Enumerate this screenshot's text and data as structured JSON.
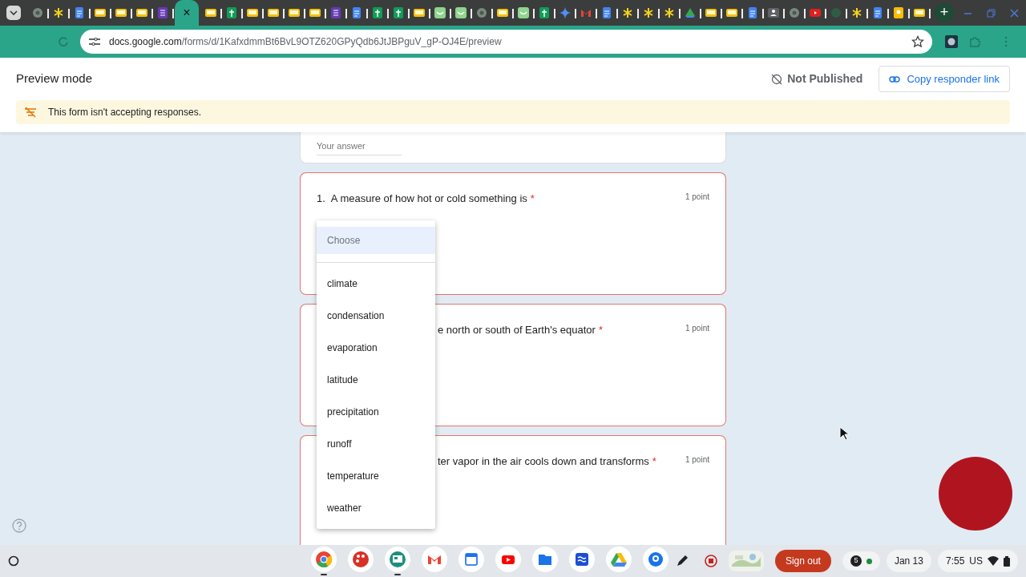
{
  "browser": {
    "tabs": [
      {
        "kind": "chrome",
        "selected": false
      },
      {
        "kind": "star",
        "selected": false
      },
      {
        "kind": "docs",
        "selected": false
      },
      {
        "kind": "slides",
        "selected": false
      },
      {
        "kind": "slides",
        "selected": false
      },
      {
        "kind": "slides",
        "selected": false
      },
      {
        "kind": "forms",
        "selected": false
      },
      {
        "selected": true,
        "close": "×"
      },
      {
        "kind": "slides",
        "selected": false
      },
      {
        "kind": "sheets",
        "selected": false
      },
      {
        "kind": "slides",
        "selected": false
      },
      {
        "kind": "slides",
        "selected": false
      },
      {
        "kind": "slides",
        "selected": false
      },
      {
        "kind": "slides",
        "selected": false
      },
      {
        "kind": "forms",
        "selected": false
      },
      {
        "kind": "docs",
        "selected": false
      },
      {
        "kind": "sheets",
        "selected": false
      },
      {
        "kind": "sheets",
        "selected": false
      },
      {
        "kind": "slides",
        "selected": false
      },
      {
        "kind": "smile",
        "selected": false
      },
      {
        "kind": "smile",
        "selected": false
      },
      {
        "kind": "chrome",
        "selected": false
      },
      {
        "kind": "slides",
        "selected": false
      },
      {
        "kind": "smile",
        "selected": false
      },
      {
        "kind": "sheets",
        "selected": false
      },
      {
        "kind": "gemini",
        "selected": false
      },
      {
        "kind": "gmail",
        "selected": false
      },
      {
        "kind": "docs",
        "selected": false
      },
      {
        "kind": "star",
        "selected": false
      },
      {
        "kind": "star",
        "selected": false
      },
      {
        "kind": "star",
        "selected": false
      },
      {
        "kind": "drive",
        "selected": false
      },
      {
        "kind": "slides",
        "selected": false
      },
      {
        "kind": "slides",
        "selected": false
      },
      {
        "kind": "docs",
        "selected": false
      },
      {
        "kind": "contacts",
        "selected": false
      },
      {
        "kind": "chrome",
        "selected": false
      },
      {
        "kind": "youtube",
        "selected": false
      },
      {
        "kind": "blank",
        "selected": false
      },
      {
        "kind": "star",
        "selected": false
      },
      {
        "kind": "docs",
        "selected": false
      },
      {
        "kind": "keep",
        "selected": false
      },
      {
        "kind": "slides",
        "selected": false
      }
    ],
    "new_tab": "+",
    "url": {
      "host": "docs.google.com",
      "path": "/forms/d/1KafxdmmBt6BvL9OTZ620GPyQdb6JtJBPguV_gP-OJ4E/preview"
    }
  },
  "header": {
    "title": "Preview mode",
    "status": "Not Published",
    "copy_button": "Copy responder link",
    "banner": "This form isn't accepting responses."
  },
  "form": {
    "answer_placeholder": "Your answer",
    "questions": [
      {
        "number": "1.",
        "text": "A measure of how hot or cold something is",
        "required_mark": "*",
        "points": "1 point"
      },
      {
        "text": "e north or south of Earth's equator",
        "required_mark": "*",
        "points": "1 point"
      },
      {
        "text": "ter vapor in the air cools down and transforms",
        "required_mark": "*",
        "points": "1 point"
      }
    ],
    "dropdown": [
      {
        "label": "Choose",
        "selected": true
      },
      {
        "label": "climate",
        "selected": false
      },
      {
        "label": "condensation",
        "selected": false
      },
      {
        "label": "evaporation",
        "selected": false
      },
      {
        "label": "latitude",
        "selected": false
      },
      {
        "label": "precipitation",
        "selected": false
      },
      {
        "label": "runoff",
        "selected": false
      },
      {
        "label": "temperature",
        "selected": false
      },
      {
        "label": "weather",
        "selected": false
      }
    ]
  },
  "taskbar": {
    "apps": [
      {
        "kind": "chrome",
        "running": true
      },
      {
        "kind": "palette",
        "running": false
      },
      {
        "kind": "classroom",
        "running": true
      },
      {
        "kind": "gmail",
        "running": false
      },
      {
        "kind": "calendar",
        "running": false
      },
      {
        "kind": "youtube",
        "running": false
      },
      {
        "kind": "files",
        "running": false
      },
      {
        "kind": "wave",
        "running": false
      },
      {
        "kind": "drive",
        "running": false
      },
      {
        "kind": "camera",
        "running": false
      }
    ],
    "sign_out": "Sign out",
    "notifications": "5",
    "date": "Jan 13",
    "time": "7:55",
    "locale": "US"
  }
}
